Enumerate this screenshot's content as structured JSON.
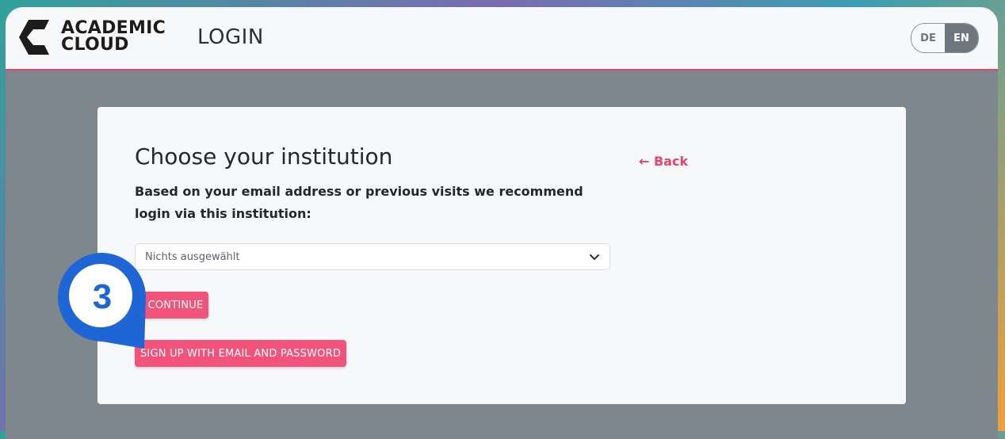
{
  "header": {
    "brand_line1": "ACADEMIC",
    "brand_line2": "CLOUD",
    "title": "LOGIN",
    "lang_de": "DE",
    "lang_en": "EN",
    "active_lang": "EN"
  },
  "card": {
    "heading": "Choose your institution",
    "description": "Based on your email address or previous visits we recommend login via this institution:",
    "back_label": "← Back",
    "select_value": "Nichts ausgewählt",
    "continue_label": "CONTINUE",
    "signup_label": "SIGN UP WITH EMAIL AND PASSWORD"
  },
  "annotation": {
    "step_number": "3"
  },
  "colors": {
    "accent": "#f3527a",
    "link": "#e8436a",
    "marker": "#1e66d6"
  },
  "icons": {
    "logo": "academic-cloud-logo",
    "select_arrow": "chevron-down-icon"
  }
}
